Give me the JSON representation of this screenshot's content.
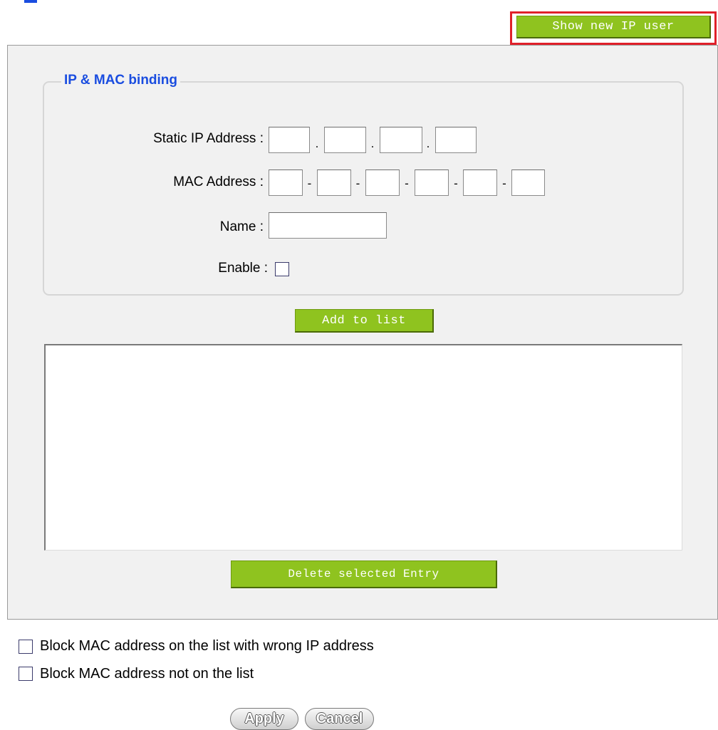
{
  "header": {
    "show_new_ip_user_label": "Show new IP user"
  },
  "binding": {
    "legend": "IP & MAC binding",
    "static_ip_label": "Static IP Address :",
    "static_ip": [
      "",
      "",
      "",
      ""
    ],
    "ip_separator": ".",
    "mac_label": "MAC Address :",
    "mac": [
      "",
      "",
      "",
      "",
      "",
      ""
    ],
    "mac_separator": "-",
    "name_label": "Name :",
    "name_value": "",
    "enable_label": "Enable :",
    "enable_checked": false
  },
  "actions": {
    "add_to_list_label": "Add to list",
    "delete_selected_label": "Delete selected Entry"
  },
  "list": {
    "entries": []
  },
  "options": {
    "block_wrong_ip_label": "Block MAC address on the list with wrong IP address",
    "block_wrong_ip_checked": false,
    "block_not_on_list_label": "Block MAC address not on the list",
    "block_not_on_list_checked": false
  },
  "footer": {
    "apply_label": "Apply",
    "cancel_label": "Cancel"
  },
  "colors": {
    "button_green": "#8fc31f",
    "highlight_red": "#e0202a",
    "legend_blue": "#1a4de0",
    "panel_gray": "#f1f1f1"
  }
}
